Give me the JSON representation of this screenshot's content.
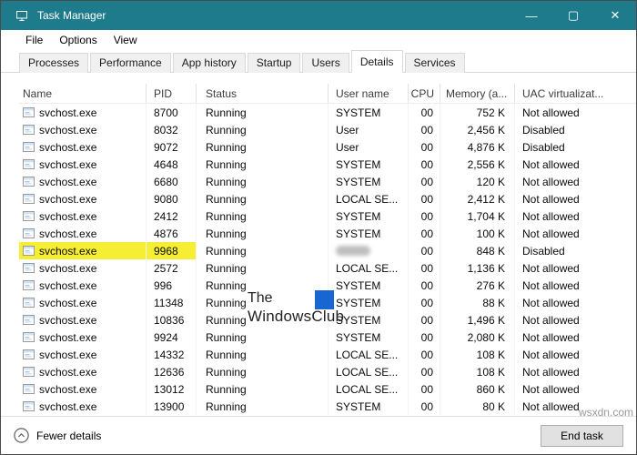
{
  "window": {
    "title": "Task Manager",
    "controls": {
      "minimize": "—",
      "maximize": "▢",
      "close": "✕"
    }
  },
  "menu": {
    "items": [
      "File",
      "Options",
      "View"
    ]
  },
  "tabs": {
    "items": [
      "Processes",
      "Performance",
      "App history",
      "Startup",
      "Users",
      "Details",
      "Services"
    ],
    "active": "Details"
  },
  "table": {
    "columns": [
      "Name",
      "PID",
      "Status",
      "User name",
      "CPU",
      "Memory (a...",
      "UAC virtualizat..."
    ],
    "rows": [
      {
        "name": "svchost.exe",
        "pid": "8700",
        "status": "Running",
        "user": "SYSTEM",
        "cpu": "00",
        "memory": "752 K",
        "uac": "Not allowed",
        "highlight": false,
        "user_blurred": false
      },
      {
        "name": "svchost.exe",
        "pid": "8032",
        "status": "Running",
        "user": "User",
        "cpu": "00",
        "memory": "2,456 K",
        "uac": "Disabled",
        "highlight": false,
        "user_blurred": false
      },
      {
        "name": "svchost.exe",
        "pid": "9072",
        "status": "Running",
        "user": "User",
        "cpu": "00",
        "memory": "4,876 K",
        "uac": "Disabled",
        "highlight": false,
        "user_blurred": false
      },
      {
        "name": "svchost.exe",
        "pid": "4648",
        "status": "Running",
        "user": "SYSTEM",
        "cpu": "00",
        "memory": "2,556 K",
        "uac": "Not allowed",
        "highlight": false,
        "user_blurred": false
      },
      {
        "name": "svchost.exe",
        "pid": "6680",
        "status": "Running",
        "user": "SYSTEM",
        "cpu": "00",
        "memory": "120 K",
        "uac": "Not allowed",
        "highlight": false,
        "user_blurred": false
      },
      {
        "name": "svchost.exe",
        "pid": "9080",
        "status": "Running",
        "user": "LOCAL SE...",
        "cpu": "00",
        "memory": "2,412 K",
        "uac": "Not allowed",
        "highlight": false,
        "user_blurred": false
      },
      {
        "name": "svchost.exe",
        "pid": "2412",
        "status": "Running",
        "user": "SYSTEM",
        "cpu": "00",
        "memory": "1,704 K",
        "uac": "Not allowed",
        "highlight": false,
        "user_blurred": false
      },
      {
        "name": "svchost.exe",
        "pid": "4876",
        "status": "Running",
        "user": "SYSTEM",
        "cpu": "00",
        "memory": "100 K",
        "uac": "Not allowed",
        "highlight": false,
        "user_blurred": false
      },
      {
        "name": "svchost.exe",
        "pid": "9968",
        "status": "Running",
        "user": "",
        "cpu": "00",
        "memory": "848 K",
        "uac": "Disabled",
        "highlight": true,
        "user_blurred": true
      },
      {
        "name": "svchost.exe",
        "pid": "2572",
        "status": "Running",
        "user": "LOCAL SE...",
        "cpu": "00",
        "memory": "1,136 K",
        "uac": "Not allowed",
        "highlight": false,
        "user_blurred": false
      },
      {
        "name": "svchost.exe",
        "pid": "996",
        "status": "Running",
        "user": "SYSTEM",
        "cpu": "00",
        "memory": "276 K",
        "uac": "Not allowed",
        "highlight": false,
        "user_blurred": false
      },
      {
        "name": "svchost.exe",
        "pid": "11348",
        "status": "Running",
        "user": "SYSTEM",
        "cpu": "00",
        "memory": "88 K",
        "uac": "Not allowed",
        "highlight": false,
        "user_blurred": false
      },
      {
        "name": "svchost.exe",
        "pid": "10836",
        "status": "Running",
        "user": "SYSTEM",
        "cpu": "00",
        "memory": "1,496 K",
        "uac": "Not allowed",
        "highlight": false,
        "user_blurred": false
      },
      {
        "name": "svchost.exe",
        "pid": "9924",
        "status": "Running",
        "user": "SYSTEM",
        "cpu": "00",
        "memory": "2,080 K",
        "uac": "Not allowed",
        "highlight": false,
        "user_blurred": false
      },
      {
        "name": "svchost.exe",
        "pid": "14332",
        "status": "Running",
        "user": "LOCAL SE...",
        "cpu": "00",
        "memory": "108 K",
        "uac": "Not allowed",
        "highlight": false,
        "user_blurred": false
      },
      {
        "name": "svchost.exe",
        "pid": "12636",
        "status": "Running",
        "user": "LOCAL SE...",
        "cpu": "00",
        "memory": "108 K",
        "uac": "Not allowed",
        "highlight": false,
        "user_blurred": false
      },
      {
        "name": "svchost.exe",
        "pid": "13012",
        "status": "Running",
        "user": "LOCAL SE...",
        "cpu": "00",
        "memory": "860 K",
        "uac": "Not allowed",
        "highlight": false,
        "user_blurred": false
      },
      {
        "name": "svchost.exe",
        "pid": "13900",
        "status": "Running",
        "user": "SYSTEM",
        "cpu": "00",
        "memory": "80 K",
        "uac": "Not allowed",
        "highlight": false,
        "user_blurred": false
      }
    ]
  },
  "footer": {
    "toggle": "Fewer details",
    "end_task": "End task"
  },
  "watermark": {
    "line1": "The",
    "line2": "WindowsClub"
  },
  "corner_text": "wsxdn.com",
  "colors": {
    "titlebar": "#1e7b8c",
    "highlight": "#f5ee33",
    "watermark_logo": "#1766d1",
    "corner_text": "#9a9a9a",
    "button_bg": "#e1e1e1",
    "button_border": "#adadad"
  }
}
